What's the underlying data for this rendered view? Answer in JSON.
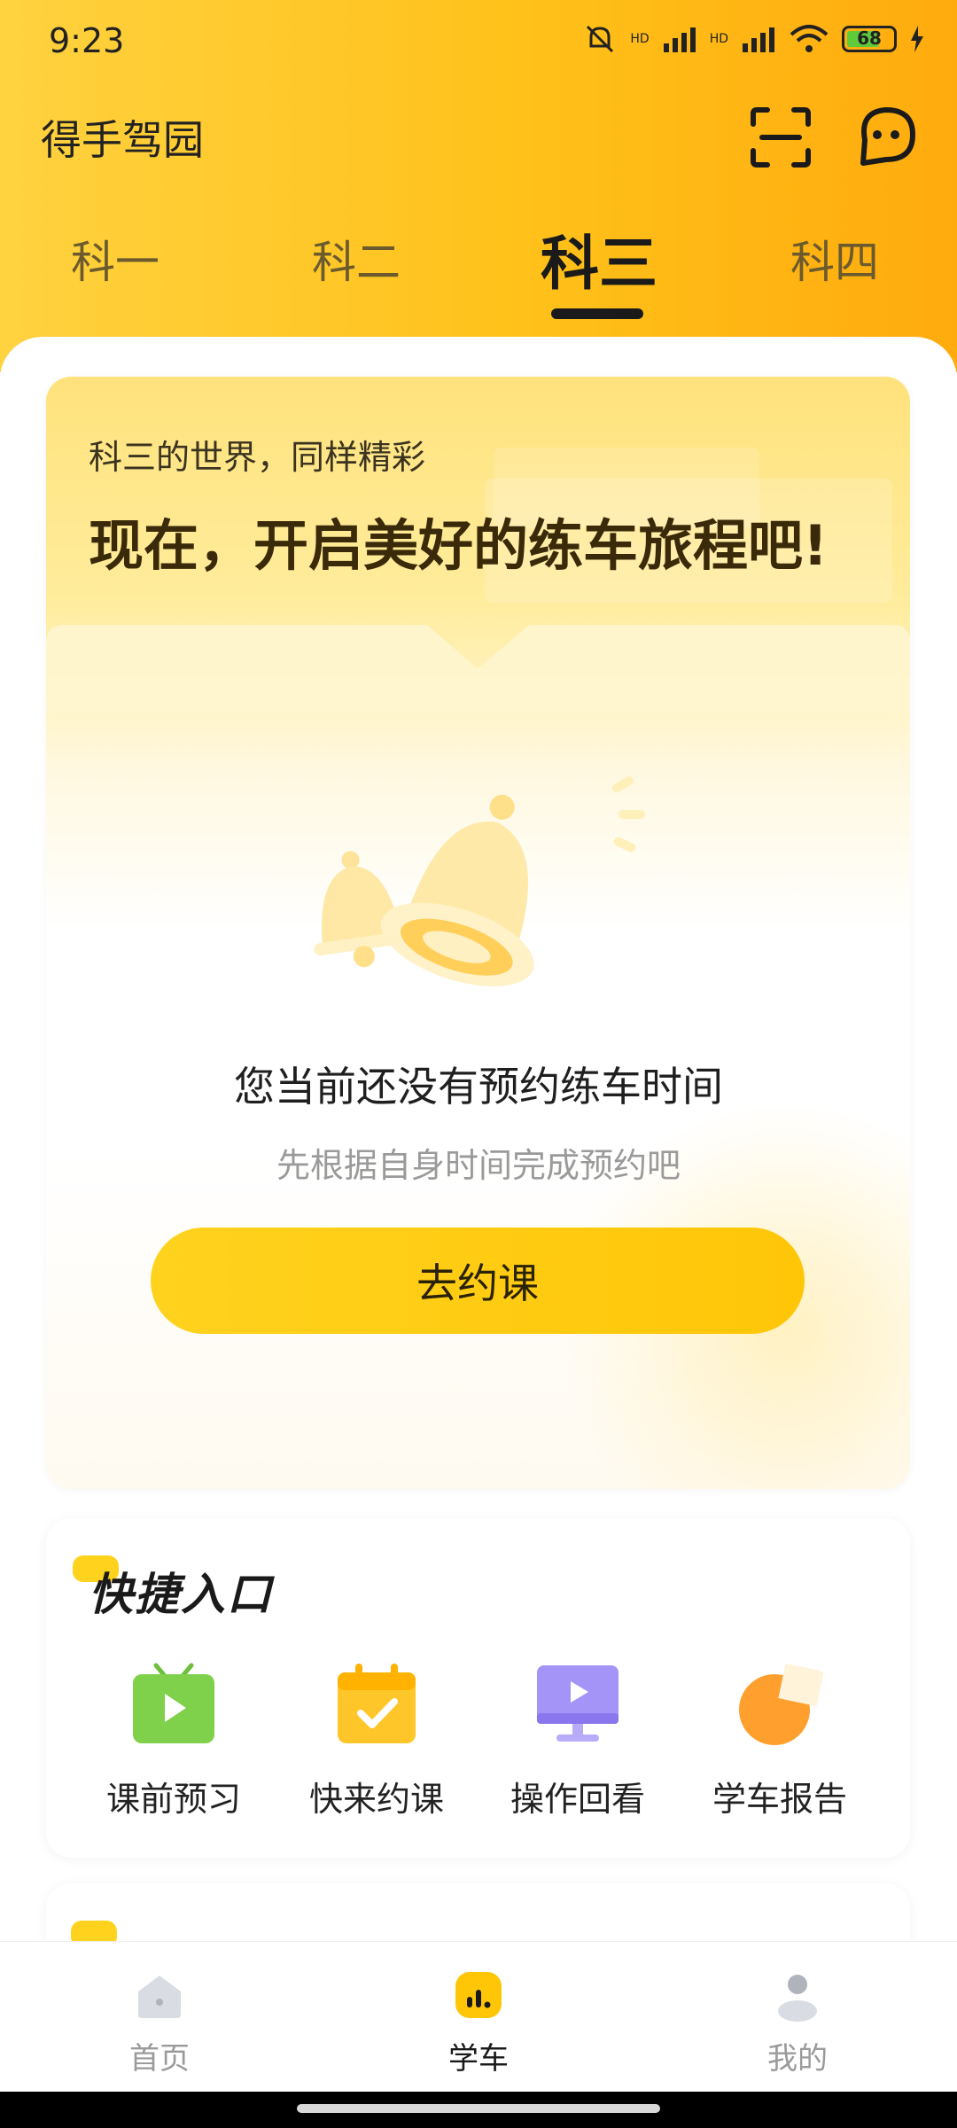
{
  "status_bar": {
    "time": "9:23",
    "signal_1": "HD",
    "signal_2": "HD",
    "battery": "68"
  },
  "app": {
    "title": "得手驾园"
  },
  "tabs": [
    {
      "label": "科一"
    },
    {
      "label": "科二"
    },
    {
      "label": "科三"
    },
    {
      "label": "科四"
    }
  ],
  "active_tab": "科三",
  "hero": {
    "subtitle": "科三的世界，同样精彩",
    "headline": "现在，开启美好的练车旅程吧!"
  },
  "empty_state": {
    "title": "您当前还没有预约练车时间",
    "subtitle": "先根据自身时间完成预约吧",
    "button_label": "去约课"
  },
  "quick_entry": {
    "title": "快捷入口",
    "items": [
      {
        "label": "课前预习",
        "icon": "tv-play-icon",
        "color": "#7fd04b"
      },
      {
        "label": "快来约课",
        "icon": "calendar-check-icon",
        "color": "#ffc62a"
      },
      {
        "label": "操作回看",
        "icon": "monitor-play-icon",
        "color": "#a594f7"
      },
      {
        "label": "学车报告",
        "icon": "report-pie-icon",
        "color": "#ff9f2e"
      }
    ]
  },
  "bottom_nav": [
    {
      "label": "首页",
      "icon": "home-icon"
    },
    {
      "label": "学车",
      "icon": "learn-chart-icon"
    },
    {
      "label": "我的",
      "icon": "profile-icon"
    }
  ],
  "active_nav": "学车",
  "colors": {
    "accent": "#ffc608",
    "header_start": "#ffd23f",
    "header_end": "#ffab0e"
  }
}
